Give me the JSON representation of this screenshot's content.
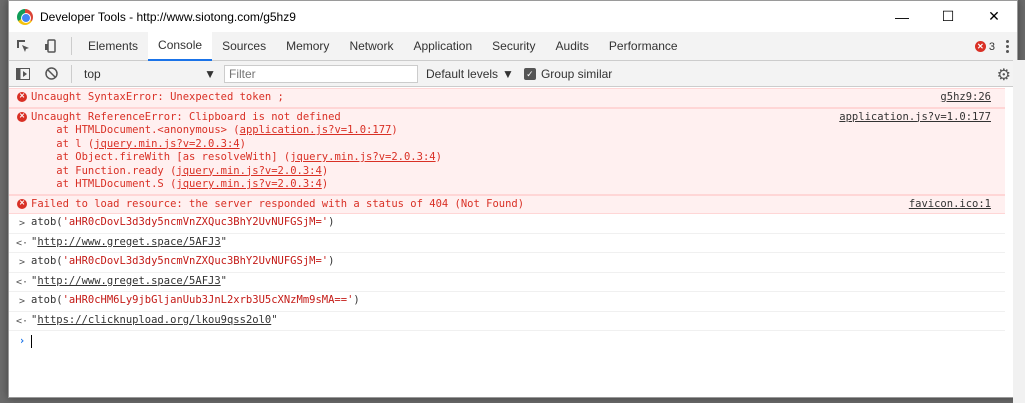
{
  "window": {
    "title": "Developer Tools - http://www.siotong.com/g5hz9",
    "minimize": "—",
    "maximize": "☐",
    "close": "✕"
  },
  "toolbar": {
    "tabs": [
      "Elements",
      "Console",
      "Sources",
      "Memory",
      "Network",
      "Application",
      "Security",
      "Audits",
      "Performance"
    ],
    "active_tab": "Console",
    "error_count": "3"
  },
  "filterbar": {
    "context": "top",
    "filter_placeholder": "Filter",
    "levels": "Default levels",
    "group_similar": "Group similar"
  },
  "console": {
    "messages": [
      {
        "type": "error",
        "text": "Uncaught SyntaxError: Unexpected token ;",
        "source": "g5hz9:26"
      },
      {
        "type": "error",
        "text": "Uncaught ReferenceError: Clipboard is not defined",
        "source": "application.js?v=1.0:177",
        "stack": [
          {
            "prefix": "    at HTMLDocument.<anonymous> (",
            "link": "application.js?v=1.0:177",
            "suffix": ")"
          },
          {
            "prefix": "    at l (",
            "link": "jquery.min.js?v=2.0.3:4",
            "suffix": ")"
          },
          {
            "prefix": "    at Object.fireWith [as resolveWith] (",
            "link": "jquery.min.js?v=2.0.3:4",
            "suffix": ")"
          },
          {
            "prefix": "    at Function.ready (",
            "link": "jquery.min.js?v=2.0.3:4",
            "suffix": ")"
          },
          {
            "prefix": "    at HTMLDocument.S (",
            "link": "jquery.min.js?v=2.0.3:4",
            "suffix": ")"
          }
        ]
      },
      {
        "type": "error",
        "text": "Failed to load resource: the server responded with a status of 404 (Not Found)",
        "source": "favicon.ico:1"
      }
    ],
    "evals": [
      {
        "fn": "atob(",
        "arg": "'aHR0cDovL3d3dy5ncmVnZXQuc3BhY2UvNUFGSjM='",
        "close": ")",
        "result_link": "http://www.greget.space/5AFJ3"
      },
      {
        "fn": "atob(",
        "arg": "'aHR0cDovL3d3dy5ncmVnZXQuc3BhY2UvNUFGSjM='",
        "close": ")",
        "result_link": "http://www.greget.space/5AFJ3"
      },
      {
        "fn": "atob(",
        "arg": "'aHR0cHM6Ly9jbGljanUub3JnL2xrb3U5cXNzMm9sMA=='",
        "close": ")",
        "result_link": "https://clicknupload.org/lkou9qss2ol0"
      }
    ]
  },
  "colors": {
    "error_bg": "#fff0f0",
    "error_text": "#d93025",
    "active_tab": "#1a73e8"
  }
}
